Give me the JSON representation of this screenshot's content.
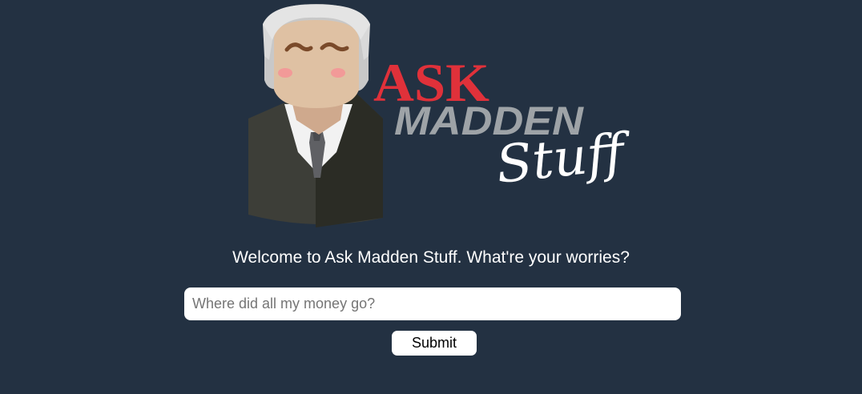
{
  "logo": {
    "word_ask": "ASK",
    "word_madden": "MADDEN",
    "word_stuff": "Stuff",
    "colors": {
      "ask_red": "#e0313a",
      "madden_gray": "#9ea3a7",
      "stuff_white": "#ffffff"
    }
  },
  "welcome": {
    "text": "Welcome to Ask Madden Stuff. What're your worries?"
  },
  "form": {
    "question_placeholder": "Where did all my money go?",
    "question_value": "",
    "submit_label": "Submit"
  },
  "colors": {
    "background": "#233142"
  }
}
